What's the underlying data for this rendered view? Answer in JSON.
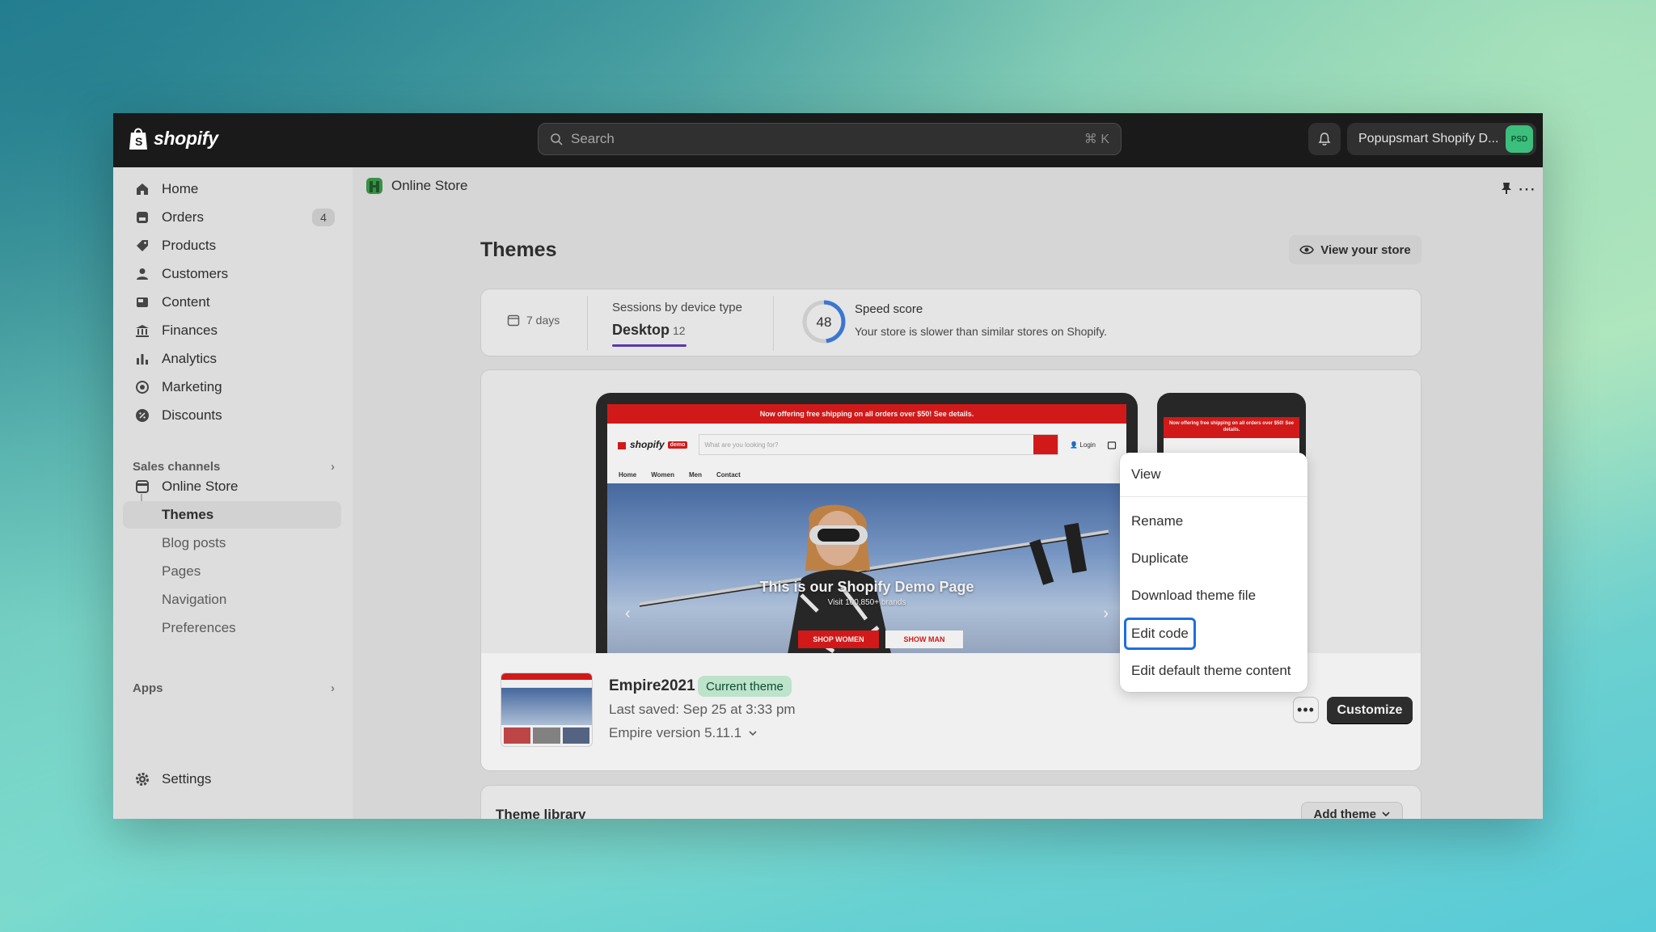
{
  "topbar": {
    "logo_text": "shopify",
    "search_placeholder": "Search",
    "search_shortcut": "⌘ K",
    "store_name": "Popupsmart Shopify D...",
    "avatar_initials": "PSD"
  },
  "sidebar": {
    "items": [
      {
        "label": "Home",
        "icon": "home-icon"
      },
      {
        "label": "Orders",
        "icon": "orders-icon",
        "badge": "4"
      },
      {
        "label": "Products",
        "icon": "tag-icon"
      },
      {
        "label": "Customers",
        "icon": "person-icon"
      },
      {
        "label": "Content",
        "icon": "content-icon"
      },
      {
        "label": "Finances",
        "icon": "bank-icon"
      },
      {
        "label": "Analytics",
        "icon": "bar-chart-icon"
      },
      {
        "label": "Marketing",
        "icon": "target-icon"
      },
      {
        "label": "Discounts",
        "icon": "discount-icon"
      }
    ],
    "sales_channels_label": "Sales channels",
    "online_store_label": "Online Store",
    "sub_items": [
      "Themes",
      "Blog posts",
      "Pages",
      "Navigation",
      "Preferences"
    ],
    "apps_label": "Apps",
    "settings_label": "Settings"
  },
  "main": {
    "breadcrumb": "Online Store",
    "title": "Themes",
    "view_store_label": "View your store",
    "stats": {
      "date_range": "7 days",
      "sessions_label": "Sessions by device type",
      "sessions_device": "Desktop",
      "sessions_value": "12",
      "speed_label": "Speed score",
      "speed_value": "48",
      "speed_fraction": 0.48,
      "speed_desc": "Your store is slower than similar stores on Shopify."
    },
    "preview": {
      "shipping_banner": "Now offering free shipping on all orders over $50! See details.",
      "site_logo": "shopify",
      "site_logo_tag": "demo",
      "site_search_placeholder": "What are you looking for?",
      "site_login": "Login",
      "site_nav": [
        "Home",
        "Women",
        "Men",
        "Contact"
      ],
      "hero_title": "This is our Shopify Demo Page",
      "hero_sub": "Visit 100,850+ brands",
      "hero_btn_women": "SHOP WOMEN",
      "hero_btn_man": "SHOW MAN",
      "phone_banner": "Now offering free shipping on all orders over $50! See details."
    },
    "theme": {
      "name": "Empire2021",
      "badge": "Current theme",
      "last_saved": "Last saved: Sep 25 at 3:33 pm",
      "version": "Empire version 5.11.1",
      "customize_label": "Customize",
      "more_label": "•••"
    },
    "library": {
      "title": "Theme library",
      "add_label": "Add theme"
    }
  },
  "menu": {
    "items": [
      "View",
      "Rename",
      "Duplicate",
      "Download theme file",
      "Edit code",
      "Edit default theme content"
    ]
  },
  "colors": {
    "topbar": "#1a1a1a",
    "accent_red": "#e01b1b",
    "focus_blue": "#1f6fe0",
    "badge_green": "#c9f2d8"
  }
}
